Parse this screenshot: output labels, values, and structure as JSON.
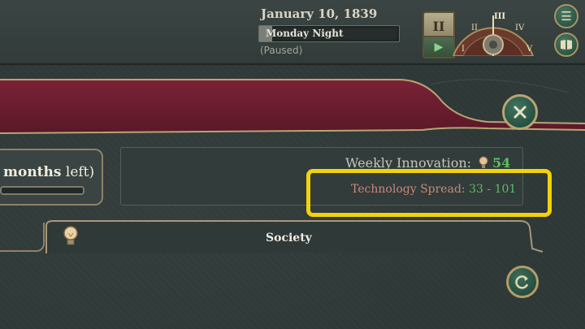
{
  "topbar": {
    "date": "January 10, 1839",
    "speed_label": "Monday Night",
    "status": "(Paused)",
    "pause_symbol": "II",
    "play_symbol": "▶",
    "speed_numerals": [
      "I",
      "II",
      "III",
      "IV",
      "V"
    ],
    "menu_icon": "menu-icon",
    "ledger_icon": "book-icon"
  },
  "left_panel": {
    "months_label": "months",
    "left_label": "left)"
  },
  "info": {
    "weekly_innovation_label": "Weekly Innovation:",
    "weekly_innovation_value": "54",
    "tech_spread_label": "Technology Spread:",
    "tech_spread_min": "33",
    "tech_spread_sep": "-",
    "tech_spread_max": "101"
  },
  "tabs": {
    "society_label": "Society"
  },
  "colors": {
    "highlight": "#f2d20b",
    "positive_value": "#5fbf63",
    "spread_label": "#c9887b",
    "banner": "#6e1f33"
  }
}
